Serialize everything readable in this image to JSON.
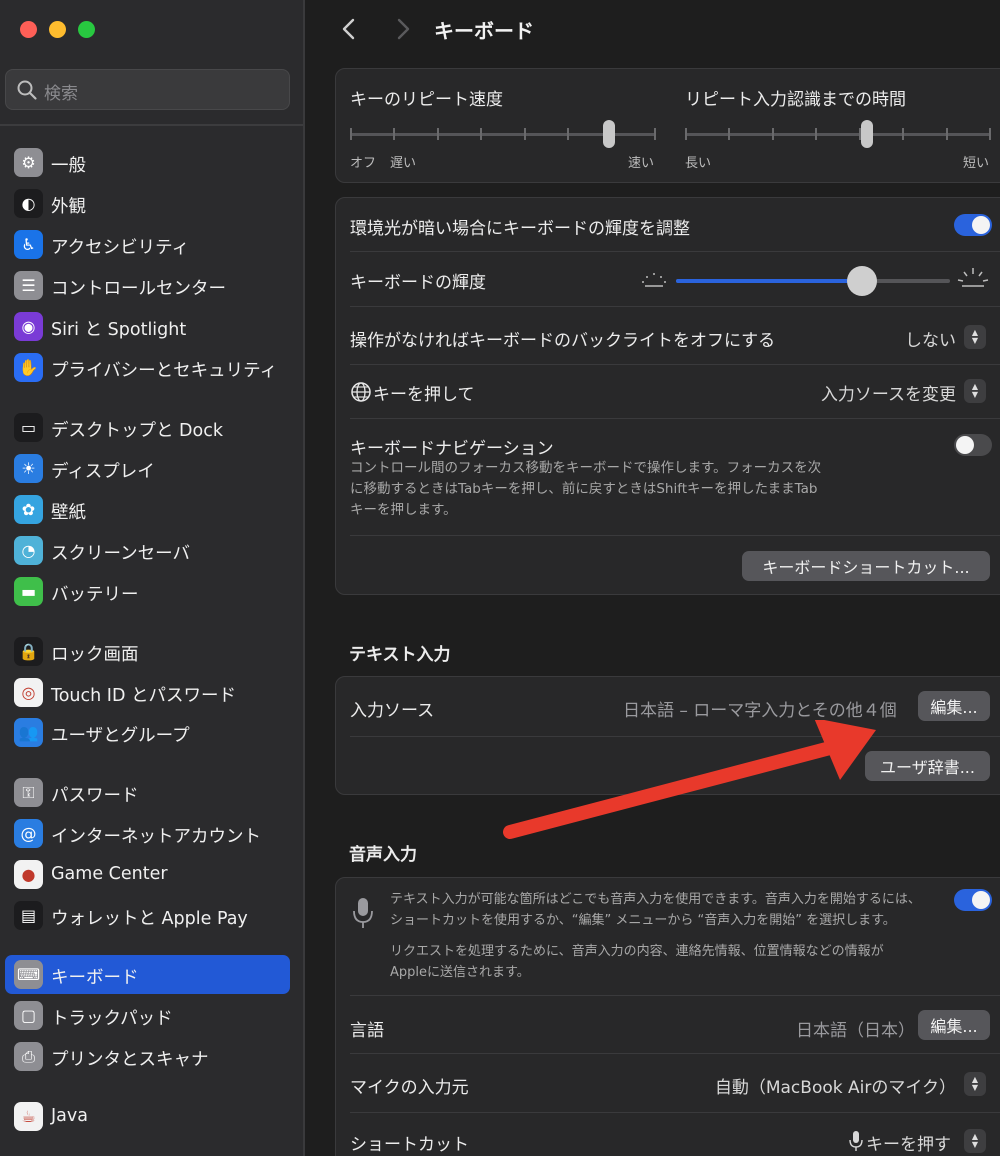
{
  "window": {
    "title": "キーボード"
  },
  "sidebar": {
    "search_placeholder": "検索",
    "items": [
      {
        "label": "一般",
        "icon": "gear-icon",
        "color": "#8e8e93"
      },
      {
        "label": "外観",
        "icon": "appearance-icon",
        "color": "#1c1c1e"
      },
      {
        "label": "アクセシビリティ",
        "icon": "accessibility-icon",
        "color": "#1a73e8"
      },
      {
        "label": "コントロールセンター",
        "icon": "control-center-icon",
        "color": "#8e8e93"
      },
      {
        "label": "Siri と Spotlight",
        "icon": "siri-icon",
        "color": "#7a3bd6"
      },
      {
        "label": "プライバシーとセキュリティ",
        "icon": "hand-icon",
        "color": "#2a6df4"
      },
      {
        "label": "デスクトップと Dock",
        "icon": "dock-icon",
        "color": "#1c1c1e"
      },
      {
        "label": "ディスプレイ",
        "icon": "sun-icon",
        "color": "#2a7de1"
      },
      {
        "label": "壁紙",
        "icon": "flower-icon",
        "color": "#35a4e0"
      },
      {
        "label": "スクリーンセーバ",
        "icon": "screensaver-icon",
        "color": "#4fb2d8"
      },
      {
        "label": "バッテリー",
        "icon": "battery-icon",
        "color": "#3fbf4a"
      },
      {
        "label": "ロック画面",
        "icon": "lock-icon",
        "color": "#1c1c1e"
      },
      {
        "label": "Touch ID とパスワード",
        "icon": "fingerprint-icon",
        "color": "#f2f2f2"
      },
      {
        "label": "ユーザとグループ",
        "icon": "users-icon",
        "color": "#2a7de1"
      },
      {
        "label": "パスワード",
        "icon": "key-icon",
        "color": "#8e8e93"
      },
      {
        "label": "インターネットアカウント",
        "icon": "at-icon",
        "color": "#2a7de1"
      },
      {
        "label": "Game Center",
        "icon": "game-center-icon",
        "color": "#f2f2f2"
      },
      {
        "label": "ウォレットと Apple Pay",
        "icon": "wallet-icon",
        "color": "#1c1c1e"
      },
      {
        "label": "キーボード",
        "icon": "keyboard-icon",
        "color": "#8e8e93",
        "selected": true
      },
      {
        "label": "トラックパッド",
        "icon": "trackpad-icon",
        "color": "#8e8e93"
      },
      {
        "label": "プリンタとスキャナ",
        "icon": "printer-icon",
        "color": "#8e8e93"
      },
      {
        "label": "Java",
        "icon": "java-icon",
        "color": "#f2f2f2"
      }
    ]
  },
  "repeat": {
    "key_repeat_label": "キーのリピート速度",
    "key_repeat_min": "オフ",
    "key_repeat_slow": "遅い",
    "key_repeat_max": "速い",
    "key_repeat_value": 0.86,
    "delay_label": "リピート入力認識までの時間",
    "delay_min": "長い",
    "delay_max": "短い",
    "delay_value": 0.6
  },
  "backlight": {
    "auto_adjust_label": "環境光が暗い場合にキーボードの輝度を調整",
    "auto_adjust_on": true,
    "brightness_label": "キーボードの輝度",
    "brightness_value": 0.68,
    "off_label": "操作がなければキーボードのバックライトをオフにする",
    "off_value": "しない",
    "globe_label": "キーを押して",
    "globe_value": "入力ソースを変更",
    "nav_label": "キーボードナビゲーション",
    "nav_desc_1": "コントロール間のフォーカス移動をキーボードで操作します。フォーカスを次",
    "nav_desc_2": "に移動するときはTabキーを押し、前に戻すときはShiftキーを押したままTab",
    "nav_desc_3": "キーを押します。",
    "nav_on": false,
    "shortcuts_button": "キーボードショートカット..."
  },
  "text_input": {
    "section_title": "テキスト入力",
    "sources_label": "入力ソース",
    "sources_value": "日本語 – ローマ字入力とその他４個",
    "edit_button": "編集...",
    "dictionary_button": "ユーザ辞書..."
  },
  "dictation": {
    "section_title": "音声入力",
    "desc_1": "テキスト入力が可能な箇所はどこでも音声入力を使用できます。音声入力を開始するには、",
    "desc_2": "ショートカットを使用するか、“編集” メニューから “音声入力を開始” を選択します。",
    "desc_3": "リクエストを処理するために、音声入力の内容、連絡先情報、位置情報などの情報が",
    "desc_4": "Appleに送信されます。",
    "enabled": true,
    "language_label": "言語",
    "language_value": "日本語（日本）",
    "language_edit": "編集...",
    "mic_label": "マイクの入力元",
    "mic_value": "自動（MacBook Airのマイク）",
    "shortcut_label": "ショートカット",
    "shortcut_value": "キーを押す"
  },
  "colors": {
    "accent": "#2a63dd",
    "selected": "#2259d6",
    "annotation_arrow": "#e8392b"
  }
}
